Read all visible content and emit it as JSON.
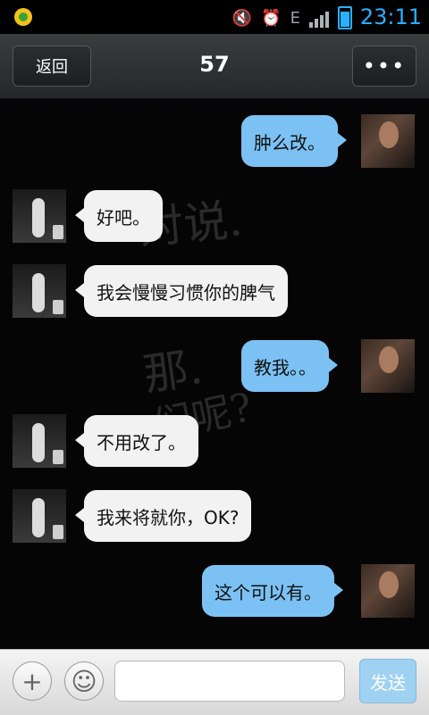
{
  "statusbar": {
    "time": "23:11",
    "network_label": "E",
    "icons": [
      "app-icon",
      "mute-icon",
      "alarm-icon",
      "signal-icon",
      "battery-icon"
    ]
  },
  "header": {
    "back_label": "返回",
    "title": "57",
    "more_label": "•••"
  },
  "watermark": {
    "line1": "对说.",
    "line2": "那.",
    "line3": "们呢?"
  },
  "messages": [
    {
      "side": "right",
      "text": "肿么改。"
    },
    {
      "side": "left",
      "text": "好吧。"
    },
    {
      "side": "left",
      "text": "我会慢慢习惯你的脾气"
    },
    {
      "side": "right",
      "text": "教我。。"
    },
    {
      "side": "left",
      "text": "不用改了。"
    },
    {
      "side": "left",
      "text": "我来将就你，OK?"
    },
    {
      "side": "right",
      "text": "这个可以有。"
    }
  ],
  "input_bar": {
    "plus_icon": "plus-icon",
    "emoji_icon": "emoji-icon",
    "message_placeholder": "",
    "send_label": "发送"
  },
  "colors": {
    "right_bubble": "#7cc1f4",
    "left_bubble": "#f2f2f2",
    "time_color": "#2ab0ff"
  }
}
